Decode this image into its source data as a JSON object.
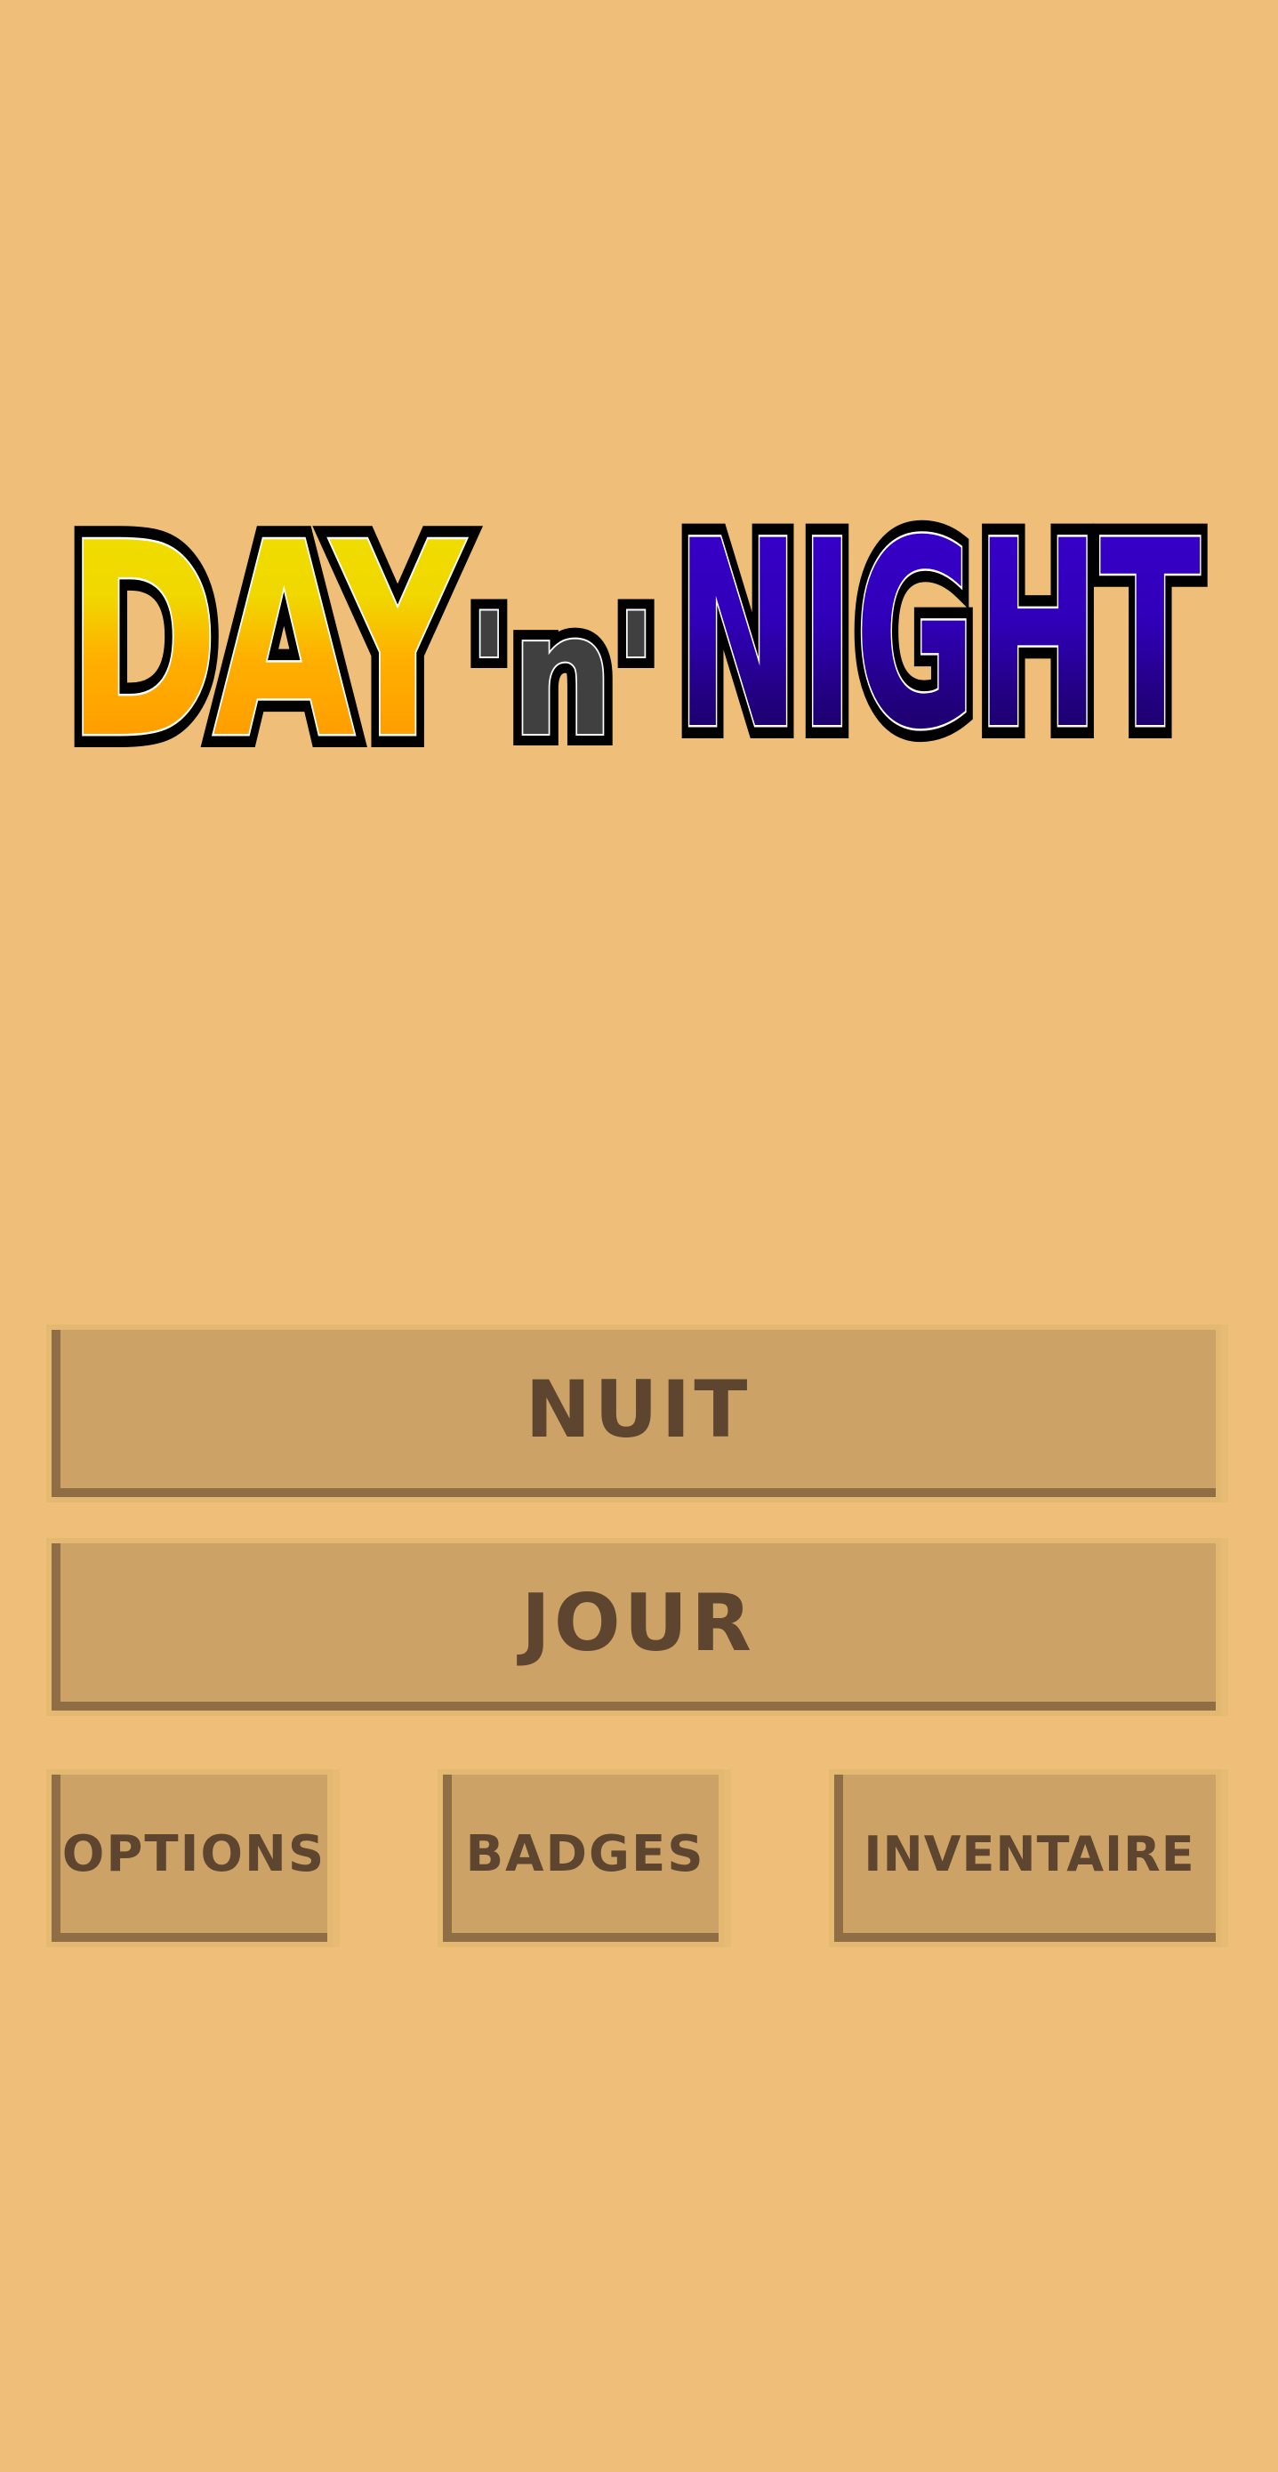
{
  "logo": {
    "day": "DAY",
    "and": "'n'",
    "night": "NIGHT",
    "colors": {
      "day_top": "#f0e000",
      "day_bottom": "#ff9a00",
      "and": "#404040",
      "night_top": "#3300cc",
      "night_bottom": "#180060",
      "outline": "#000000",
      "inner_outline": "#ffffff"
    }
  },
  "menu": {
    "nuit": "NUIT",
    "jour": "JOUR",
    "options": "OPTIONS",
    "badges": "BADGES",
    "inventaire": "INVENTAIRE"
  },
  "colors": {
    "background": "#efbf79",
    "button_face": "#cca266",
    "button_shadow": "#8f6e45",
    "button_text": "#5d4530"
  }
}
